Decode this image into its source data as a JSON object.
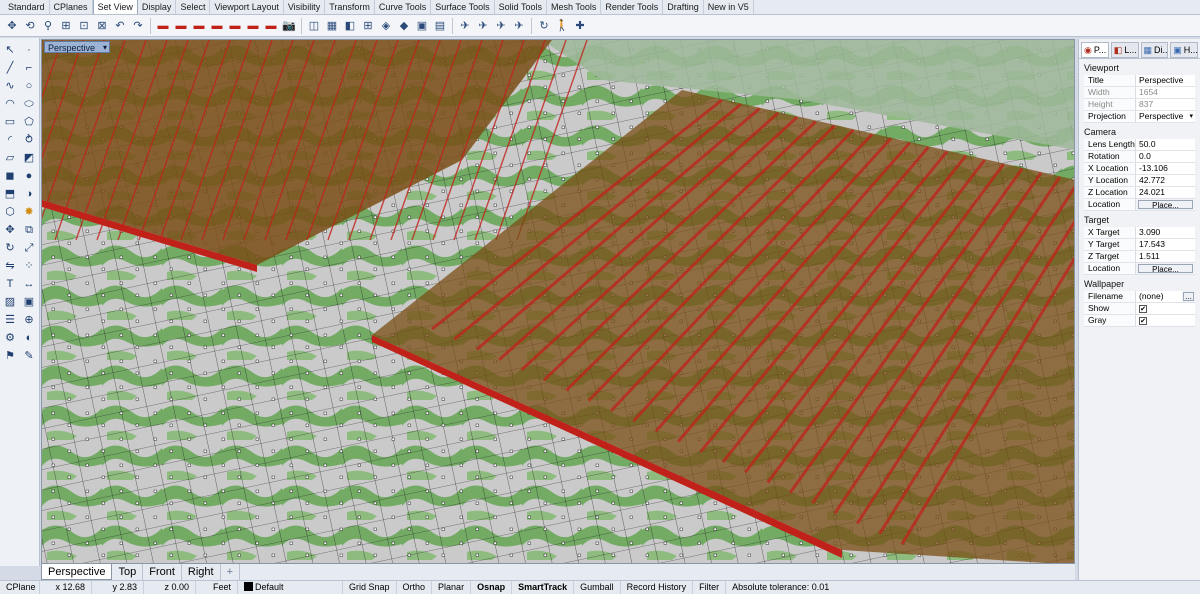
{
  "toolbar_tabs": [
    "Standard",
    "CPlanes",
    "Set View",
    "Display",
    "Select",
    "Viewport Layout",
    "Visibility",
    "Transform",
    "Curve Tools",
    "Surface Tools",
    "Solid Tools",
    "Mesh Tools",
    "Render Tools",
    "Drafting",
    "New in V5"
  ],
  "active_tab_index": 2,
  "viewport": {
    "title": "Perspective"
  },
  "viewport_tabs": [
    "Perspective",
    "Top",
    "Front",
    "Right"
  ],
  "viewport_tab_add": "+",
  "panel": {
    "tabs": [
      "P...",
      "L...",
      "Di...",
      "H..."
    ],
    "sections": {
      "viewport": {
        "header": "Viewport",
        "title_label": "Title",
        "title_value": "Perspective",
        "width_label": "Width",
        "width_value": "1654",
        "height_label": "Height",
        "height_value": "837",
        "projection_label": "Projection",
        "projection_value": "Perspective"
      },
      "camera": {
        "header": "Camera",
        "lens_label": "Lens Length",
        "lens_value": "50.0",
        "rotation_label": "Rotation",
        "rotation_value": "0.0",
        "xloc_label": "X Location",
        "xloc_value": "-13.106",
        "yloc_label": "Y Location",
        "yloc_value": "42.772",
        "zloc_label": "Z Location",
        "zloc_value": "24.021",
        "location_label": "Location",
        "location_button": "Place..."
      },
      "target": {
        "header": "Target",
        "xt_label": "X Target",
        "xt_value": "3.090",
        "yt_label": "Y Target",
        "yt_value": "17.543",
        "zt_label": "Z Target",
        "zt_value": "1.511",
        "location_label": "Location",
        "location_button": "Place..."
      },
      "wallpaper": {
        "header": "Wallpaper",
        "filename_label": "Filename",
        "filename_value": "(none)",
        "browse_button": "...",
        "show_label": "Show",
        "show_checked": true,
        "gray_label": "Gray",
        "gray_checked": true
      }
    }
  },
  "status": {
    "cplane": "CPlane",
    "x": "x 12.68",
    "y": "y 2.83",
    "z": "z 0.00",
    "units": "Feet",
    "layer": "Default",
    "grid_snap": "Grid Snap",
    "ortho": "Ortho",
    "planar": "Planar",
    "osnap": "Osnap",
    "smarttrack": "SmartTrack",
    "gumball": "Gumball",
    "record_history": "Record History",
    "filter": "Filter",
    "tolerance": "Absolute tolerance: 0.01"
  },
  "colors": {
    "terrain_green": "#6aa85a",
    "terrain_gray": "#c9c9c9",
    "plane_brown": "#7a4e16",
    "plane_red": "#c0221a",
    "layer_swatch": "#000000"
  }
}
